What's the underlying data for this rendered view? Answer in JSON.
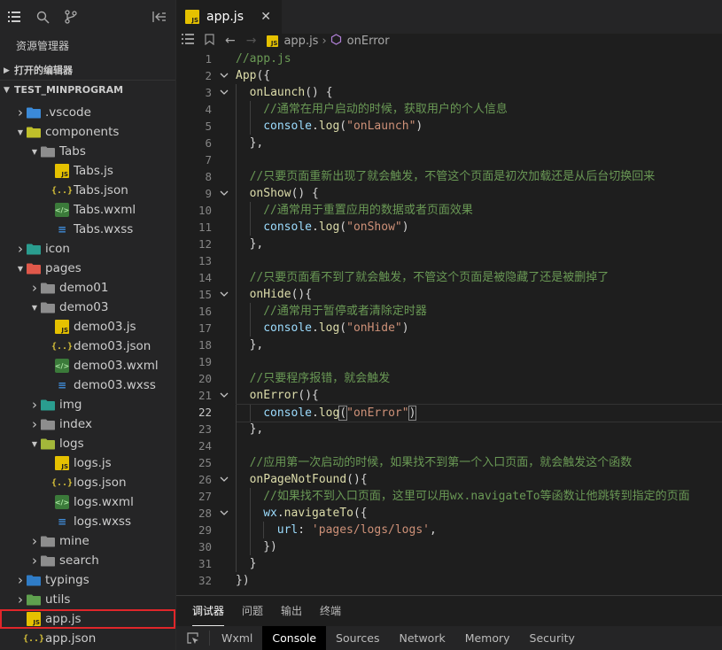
{
  "sidebar": {
    "title": "资源管理器",
    "open_editors": "打开的编辑器",
    "project": "TEST_MINPROGRAM",
    "tree": [
      {
        "label": ".vscode",
        "indent": 1,
        "twisty": "closed",
        "icon": "folder-vscode"
      },
      {
        "label": "components",
        "indent": 1,
        "twisty": "open",
        "icon": "folder-components"
      },
      {
        "label": "Tabs",
        "indent": 2,
        "twisty": "open",
        "icon": "folder"
      },
      {
        "label": "Tabs.js",
        "indent": 3,
        "twisty": "",
        "icon": "js"
      },
      {
        "label": "Tabs.json",
        "indent": 3,
        "twisty": "",
        "icon": "json"
      },
      {
        "label": "Tabs.wxml",
        "indent": 3,
        "twisty": "",
        "icon": "wxml"
      },
      {
        "label": "Tabs.wxss",
        "indent": 3,
        "twisty": "",
        "icon": "wxss"
      },
      {
        "label": "icon",
        "indent": 1,
        "twisty": "closed",
        "icon": "folder-image"
      },
      {
        "label": "pages",
        "indent": 1,
        "twisty": "open",
        "icon": "folder-pages"
      },
      {
        "label": "demo01",
        "indent": 2,
        "twisty": "closed",
        "icon": "folder"
      },
      {
        "label": "demo03",
        "indent": 2,
        "twisty": "open",
        "icon": "folder"
      },
      {
        "label": "demo03.js",
        "indent": 3,
        "twisty": "",
        "icon": "js"
      },
      {
        "label": "demo03.json",
        "indent": 3,
        "twisty": "",
        "icon": "json"
      },
      {
        "label": "demo03.wxml",
        "indent": 3,
        "twisty": "",
        "icon": "wxml"
      },
      {
        "label": "demo03.wxss",
        "indent": 3,
        "twisty": "",
        "icon": "wxss"
      },
      {
        "label": "img",
        "indent": 2,
        "twisty": "closed",
        "icon": "folder-image"
      },
      {
        "label": "index",
        "indent": 2,
        "twisty": "closed",
        "icon": "folder"
      },
      {
        "label": "logs",
        "indent": 2,
        "twisty": "open",
        "icon": "folder-logs"
      },
      {
        "label": "logs.js",
        "indent": 3,
        "twisty": "",
        "icon": "js"
      },
      {
        "label": "logs.json",
        "indent": 3,
        "twisty": "",
        "icon": "json"
      },
      {
        "label": "logs.wxml",
        "indent": 3,
        "twisty": "",
        "icon": "wxml"
      },
      {
        "label": "logs.wxss",
        "indent": 3,
        "twisty": "",
        "icon": "wxss"
      },
      {
        "label": "mine",
        "indent": 2,
        "twisty": "closed",
        "icon": "folder"
      },
      {
        "label": "search",
        "indent": 2,
        "twisty": "closed",
        "icon": "folder"
      },
      {
        "label": "typings",
        "indent": 1,
        "twisty": "closed",
        "icon": "folder-ts"
      },
      {
        "label": "utils",
        "indent": 1,
        "twisty": "closed",
        "icon": "folder-utils"
      },
      {
        "label": "app.js",
        "indent": 1,
        "twisty": "",
        "icon": "js",
        "selected": true
      },
      {
        "label": "app.json",
        "indent": 1,
        "twisty": "",
        "icon": "json"
      }
    ]
  },
  "editor": {
    "tab_label": "app.js",
    "breadcrumb_file": "app.js",
    "breadcrumb_symbol": "onError",
    "current_line": 22,
    "lines": [
      {
        "n": "1",
        "fold": "",
        "depth": 0,
        "tokens": [
          [
            "c-comment",
            "//app.js"
          ]
        ]
      },
      {
        "n": "2",
        "fold": "v",
        "depth": 0,
        "tokens": [
          [
            "c-fn",
            "App"
          ],
          [
            "c-punc",
            "({"
          ]
        ]
      },
      {
        "n": "3",
        "fold": "v",
        "depth": 1,
        "tokens": [
          [
            "c-fn",
            "onLaunch"
          ],
          [
            "c-punc",
            "() {"
          ]
        ]
      },
      {
        "n": "4",
        "fold": "",
        "depth": 2,
        "tokens": [
          [
            "c-comment",
            "//通常在用户启动的时候，获取用户的个人信息"
          ]
        ]
      },
      {
        "n": "5",
        "fold": "",
        "depth": 2,
        "tokens": [
          [
            "c-var",
            "console"
          ],
          [
            "c-punc",
            "."
          ],
          [
            "c-fn",
            "log"
          ],
          [
            "c-punc",
            "("
          ],
          [
            "c-str",
            "\"onLaunch\""
          ],
          [
            "c-punc",
            ")"
          ]
        ]
      },
      {
        "n": "6",
        "fold": "",
        "depth": 1,
        "tokens": [
          [
            "c-punc",
            "},"
          ]
        ]
      },
      {
        "n": "7",
        "fold": "",
        "depth": 1,
        "tokens": []
      },
      {
        "n": "8",
        "fold": "",
        "depth": 1,
        "tokens": [
          [
            "c-comment",
            "//只要页面重新出现了就会触发，不管这个页面是初次加载还是从后台切换回来"
          ]
        ]
      },
      {
        "n": "9",
        "fold": "v",
        "depth": 1,
        "tokens": [
          [
            "c-fn",
            "onShow"
          ],
          [
            "c-punc",
            "() {"
          ]
        ]
      },
      {
        "n": "10",
        "fold": "",
        "depth": 2,
        "tokens": [
          [
            "c-comment",
            "//通常用于重置应用的数据或者页面效果"
          ]
        ]
      },
      {
        "n": "11",
        "fold": "",
        "depth": 2,
        "tokens": [
          [
            "c-var",
            "console"
          ],
          [
            "c-punc",
            "."
          ],
          [
            "c-fn",
            "log"
          ],
          [
            "c-punc",
            "("
          ],
          [
            "c-str",
            "\"onShow\""
          ],
          [
            "c-punc",
            ")"
          ]
        ]
      },
      {
        "n": "12",
        "fold": "",
        "depth": 1,
        "tokens": [
          [
            "c-punc",
            "},"
          ]
        ]
      },
      {
        "n": "13",
        "fold": "",
        "depth": 1,
        "tokens": []
      },
      {
        "n": "14",
        "fold": "",
        "depth": 1,
        "tokens": [
          [
            "c-comment",
            "//只要页面看不到了就会触发，不管这个页面是被隐藏了还是被删掉了"
          ]
        ]
      },
      {
        "n": "15",
        "fold": "v",
        "depth": 1,
        "tokens": [
          [
            "c-fn",
            "onHide"
          ],
          [
            "c-punc",
            "(){"
          ]
        ]
      },
      {
        "n": "16",
        "fold": "",
        "depth": 2,
        "tokens": [
          [
            "c-comment",
            "//通常用于暂停或者清除定时器"
          ]
        ]
      },
      {
        "n": "17",
        "fold": "",
        "depth": 2,
        "tokens": [
          [
            "c-var",
            "console"
          ],
          [
            "c-punc",
            "."
          ],
          [
            "c-fn",
            "log"
          ],
          [
            "c-punc",
            "("
          ],
          [
            "c-str",
            "\"onHide\""
          ],
          [
            "c-punc",
            ")"
          ]
        ]
      },
      {
        "n": "18",
        "fold": "",
        "depth": 1,
        "tokens": [
          [
            "c-punc",
            "},"
          ]
        ]
      },
      {
        "n": "19",
        "fold": "",
        "depth": 1,
        "tokens": []
      },
      {
        "n": "20",
        "fold": "",
        "depth": 1,
        "tokens": [
          [
            "c-comment",
            "//只要程序报错，就会触发"
          ]
        ]
      },
      {
        "n": "21",
        "fold": "v",
        "depth": 1,
        "tokens": [
          [
            "c-fn",
            "onError"
          ],
          [
            "c-punc",
            "(){"
          ]
        ]
      },
      {
        "n": "22",
        "fold": "",
        "depth": 2,
        "tokens": [
          [
            "c-var",
            "console"
          ],
          [
            "c-punc",
            "."
          ],
          [
            "c-fn",
            "log"
          ],
          [
            "c-punc bracket-box",
            "("
          ],
          [
            "c-str",
            "\"onError\""
          ],
          [
            "c-punc bracket-box",
            ")"
          ]
        ]
      },
      {
        "n": "23",
        "fold": "",
        "depth": 1,
        "tokens": [
          [
            "c-punc",
            "},"
          ]
        ]
      },
      {
        "n": "24",
        "fold": "",
        "depth": 1,
        "tokens": []
      },
      {
        "n": "25",
        "fold": "",
        "depth": 1,
        "tokens": [
          [
            "c-comment",
            "//应用第一次启动的时候，如果找不到第一个入口页面，就会触发这个函数"
          ]
        ]
      },
      {
        "n": "26",
        "fold": "v",
        "depth": 1,
        "tokens": [
          [
            "c-fn",
            "onPageNotFound"
          ],
          [
            "c-punc",
            "(){"
          ]
        ]
      },
      {
        "n": "27",
        "fold": "",
        "depth": 2,
        "tokens": [
          [
            "c-comment",
            "//如果找不到入口页面，这里可以用wx.navigateTo等函数让他跳转到指定的页面"
          ]
        ]
      },
      {
        "n": "28",
        "fold": "v",
        "depth": 2,
        "tokens": [
          [
            "c-var",
            "wx"
          ],
          [
            "c-punc",
            "."
          ],
          [
            "c-fn",
            "navigateTo"
          ],
          [
            "c-punc",
            "({"
          ]
        ]
      },
      {
        "n": "29",
        "fold": "",
        "depth": 3,
        "tokens": [
          [
            "c-var",
            "url"
          ],
          [
            "c-punc",
            ": "
          ],
          [
            "c-str",
            "'pages/logs/logs'"
          ],
          [
            "c-punc",
            ","
          ]
        ]
      },
      {
        "n": "30",
        "fold": "",
        "depth": 2,
        "tokens": [
          [
            "c-punc",
            "})"
          ]
        ]
      },
      {
        "n": "31",
        "fold": "",
        "depth": 1,
        "tokens": [
          [
            "c-punc",
            "}"
          ]
        ]
      },
      {
        "n": "32",
        "fold": "",
        "depth": 0,
        "tokens": [
          [
            "c-punc",
            "})"
          ]
        ]
      }
    ]
  },
  "panel": {
    "tabs": [
      "调试器",
      "问题",
      "输出",
      "终端"
    ],
    "active_tab": "调试器",
    "devtools_tabs": [
      "Wxml",
      "Console",
      "Sources",
      "Network",
      "Memory",
      "Security"
    ],
    "active_devtools_tab": "Console"
  },
  "colors": {
    "selection_outline": "#e0262a",
    "js_icon": "#e5c100",
    "wxml_icon": "#3b7a3a",
    "wxss_icon": "#3f8ad6",
    "comment": "#6a9955",
    "function": "#dcdcaa",
    "string": "#ce9178",
    "variable": "#9cdcfe"
  }
}
